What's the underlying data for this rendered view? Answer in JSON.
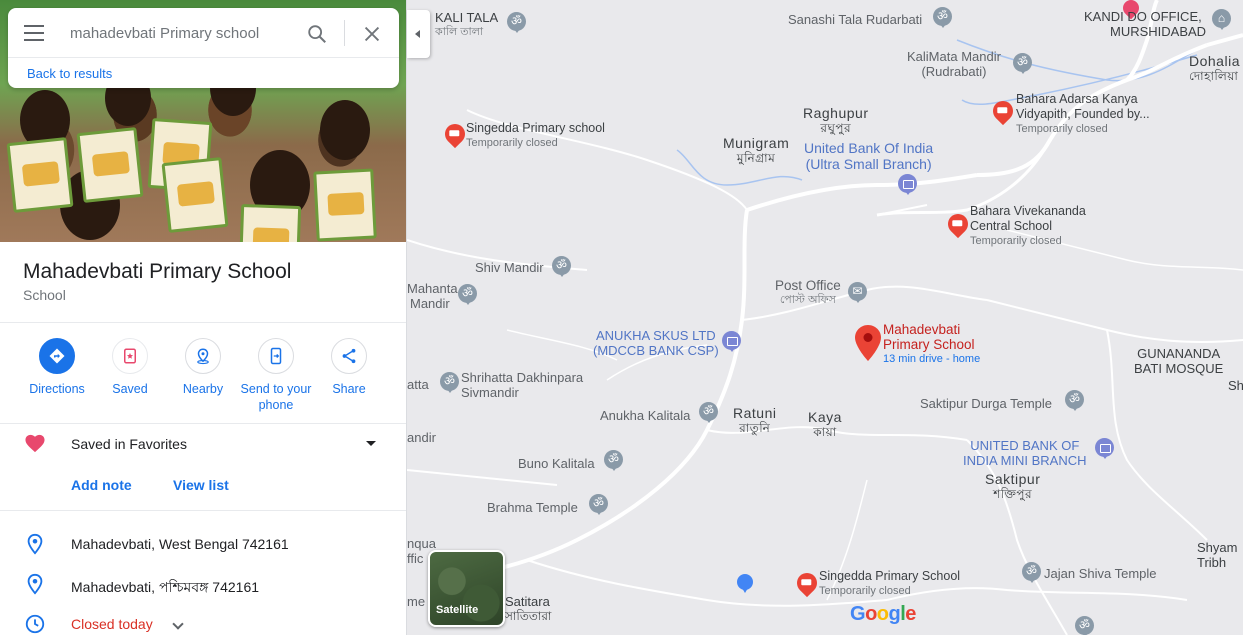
{
  "search": {
    "value": "mahadevbati Primary school",
    "back_label": "Back to results"
  },
  "place": {
    "title": "Mahadevbati Primary School",
    "category": "School"
  },
  "actions": {
    "directions": "Directions",
    "saved": "Saved",
    "nearby": "Nearby",
    "send_line1": "Send to your",
    "send_line2": "phone",
    "share": "Share"
  },
  "saved_list": {
    "label": "Saved in Favorites",
    "add_note": "Add note",
    "view_list": "View list"
  },
  "info": {
    "address1": "Mahadevbati, West Bengal 742161",
    "address2": "Mahadevbati, পশ্চিমবঙ্গ 742161",
    "hours": "Closed today"
  },
  "map": {
    "labels": {
      "kali_tala": "KALI TALA",
      "kali_tala_bn": "কালি তালা",
      "sanashi": "Sanashi Tala Rudarbati",
      "kandi_office": "KANDI DO OFFICE,",
      "murshidabad": "MURSHIDABAD",
      "dohalia": "Dohalia",
      "dohalia_bn": "দোহালিয়া",
      "kalimata": "KaliMata Mandir",
      "rudrabati": "(Rudrabati)",
      "bahara_adarsa1": "Bahara Adarsa Kanya",
      "bahara_adarsa2": "Vidyapith, Founded by...",
      "temp_closed": "Temporarily closed",
      "raghupur": "Raghupur",
      "raghupur_bn": "রঘুপুর",
      "singedda1": "Singedda Primary school",
      "munigram": "Munigram",
      "munigram_bn": "মুনিগ্রাম",
      "uboi1": "United Bank Of India",
      "uboi2": "(Ultra Small Branch)",
      "bahara_viv1": "Bahara Vivekananda",
      "bahara_viv2": "Central School",
      "shiv_mandir": "Shiv Mandir",
      "mahanta1": "Mahanta",
      "mahanta2": "Mandir",
      "post_office": "Post Office",
      "post_office_bn": "পোস্ট অফিস",
      "anukha1": "ANUKHA SKUS LTD",
      "anukha2": "(MDCCB BANK CSP)",
      "main_pin1": "Mahadevbati",
      "main_pin2": "Primary School",
      "main_pin_drive": "13 min drive - home",
      "gunananda1": "GUNANANDA",
      "gunananda2": "BATI MOSQUE",
      "atta": "atta",
      "shrihatta1": "Shrihatta Dakhinpara",
      "shrihatta2": "Sivmandir",
      "anukha_kalitala": "Anukha Kalitala",
      "ratuni": "Ratuni",
      "ratuni_bn": "রাতুনি",
      "kaya": "Kaya",
      "kaya_bn": "কায়া",
      "saktipur_durga": "Saktipur Durga Temple",
      "sh": "Sh",
      "andir": "andir",
      "ubi_mini1": "UNITED BANK OF",
      "ubi_mini2": "INDIA MINI BRANCH",
      "buno_kalitala": "Buno Kalitala",
      "saktipur": "Saktipur",
      "saktipur_bn": "শক্তিপুর",
      "brahma_temple": "Brahma Temple",
      "nqua": "nqua",
      "ffic": "ffic",
      "shyam1": "Shyam",
      "shyam2": "Tribh",
      "singedda2": "Singedda Primary School",
      "jajan_shiva": "Jajan Shiva Temple",
      "me": "me",
      "satitara": "Satitara",
      "satitara_bn": "সাতিতারা"
    },
    "satellite_label": "Satellite",
    "google_logo": "Google"
  }
}
